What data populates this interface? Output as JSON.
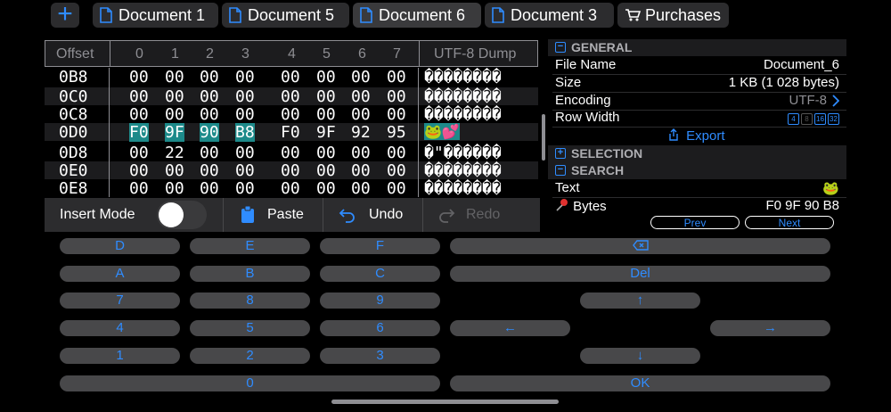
{
  "tabs": [
    {
      "label": "Document 1",
      "icon": "document-icon"
    },
    {
      "label": "Document 5",
      "icon": "document-icon"
    },
    {
      "label": "Document 6",
      "icon": "document-icon",
      "active": true
    },
    {
      "label": "Document 3",
      "icon": "document-icon"
    },
    {
      "label": "Purchases",
      "icon": "cart-icon"
    }
  ],
  "add_tab_label": "+",
  "hex": {
    "columns": [
      "Offset",
      "0",
      "1",
      "2",
      "3",
      "4",
      "5",
      "6",
      "7",
      "UTF-8 Dump"
    ],
    "rows": [
      {
        "offset": "0B8",
        "bytes": [
          "00",
          "00",
          "00",
          "00",
          "00",
          "00",
          "00",
          "00"
        ],
        "dump": "��������"
      },
      {
        "offset": "0C0",
        "bytes": [
          "00",
          "00",
          "00",
          "00",
          "00",
          "00",
          "00",
          "00"
        ],
        "dump": "��������"
      },
      {
        "offset": "0C8",
        "bytes": [
          "00",
          "00",
          "00",
          "00",
          "00",
          "00",
          "00",
          "00"
        ],
        "dump": "��������"
      },
      {
        "offset": "0D0",
        "bytes": [
          "F0",
          "9F",
          "90",
          "B8",
          "F0",
          "9F",
          "92",
          "95"
        ],
        "dump": "🐸💕"
      },
      {
        "offset": "0D8",
        "bytes": [
          "00",
          "22",
          "00",
          "00",
          "00",
          "00",
          "00",
          "00"
        ],
        "dump": "�\"������"
      },
      {
        "offset": "0E0",
        "bytes": [
          "00",
          "00",
          "00",
          "00",
          "00",
          "00",
          "00",
          "00"
        ],
        "dump": "��������"
      },
      {
        "offset": "0E8",
        "bytes": [
          "00",
          "00",
          "00",
          "00",
          "00",
          "00",
          "00",
          "00"
        ],
        "dump": "��������"
      }
    ]
  },
  "toolbar": {
    "insert_mode": "Insert Mode",
    "paste": "Paste",
    "undo": "Undo",
    "redo": "Redo"
  },
  "info": {
    "general": "GENERAL",
    "file_name_label": "File Name",
    "file_name": "Document_6",
    "size_label": "Size",
    "size": "1 KB (1 028 bytes)",
    "encoding_label": "Encoding",
    "encoding": "UTF-8",
    "row_width_label": "Row Width",
    "row_width_options": [
      "4",
      "8",
      "16",
      "32"
    ],
    "export": "Export",
    "selection": "SELECTION",
    "search": "SEARCH",
    "text_label": "Text",
    "text_value": "🐸",
    "bytes_label": "Bytes",
    "bytes_value": "F0 9F 90 B8",
    "prev": "Prev",
    "next": "Next"
  },
  "keypad": {
    "D": "D",
    "E": "E",
    "F": "F",
    "A": "A",
    "B": "B",
    "C": "C",
    "7": "7",
    "8": "8",
    "9": "9",
    "4": "4",
    "5": "5",
    "6": "6",
    "1": "1",
    "2": "2",
    "3": "3",
    "0": "0",
    "del": "Del",
    "up": "↑",
    "down": "↓",
    "left": "←",
    "right": "→",
    "ok": "OK"
  },
  "colors": {
    "accent": "#2f8cff",
    "highlight": "#1d8a8a"
  }
}
